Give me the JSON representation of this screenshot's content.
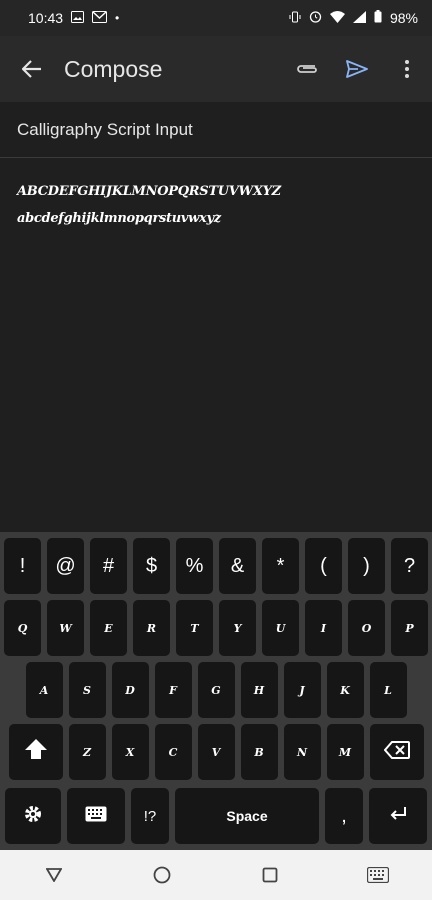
{
  "status": {
    "time": "10:43",
    "left_icons": [
      "image-icon",
      "gmail-icon",
      "dot-icon"
    ],
    "right_icons": [
      "vibrate-icon",
      "alarm-icon",
      "wifi-icon",
      "signal-icon",
      "battery-icon"
    ],
    "battery": "98%"
  },
  "appbar": {
    "title": "Compose",
    "back_icon": "arrow-left",
    "actions": [
      "attach-icon",
      "send-icon",
      "more-icon"
    ]
  },
  "subject": {
    "value": "Calligraphy Script Input"
  },
  "body": {
    "line1": "ABCDEFGHIJKLMNOPQRSTUVWXYZ",
    "line2": "abcdefghijklmnopqrstuvwxyz"
  },
  "keyboard": {
    "row1": [
      "!",
      "@",
      "#",
      "$",
      "%",
      "&",
      "*",
      "(",
      ")",
      "?"
    ],
    "row2": [
      "Q",
      "W",
      "E",
      "R",
      "T",
      "Y",
      "U",
      "I",
      "O",
      "P"
    ],
    "row3": [
      "A",
      "S",
      "D",
      "F",
      "G",
      "H",
      "J",
      "K",
      "L"
    ],
    "row4": [
      "Z",
      "X",
      "C",
      "V",
      "B",
      "N",
      "M"
    ],
    "shift_icon": "shift-icon",
    "backspace_icon": "backspace-icon",
    "row5": {
      "settings_icon": "gear-icon",
      "keyboard_icon": "keyboard-icon",
      "symbols_label": "!?",
      "space_label": "Space",
      "comma_label": ",",
      "enter_icon": "enter-icon"
    }
  },
  "navbar": {
    "items": [
      "back-triangle-icon",
      "home-circle-icon",
      "recents-square-icon",
      "keyboard-switch-icon"
    ]
  }
}
